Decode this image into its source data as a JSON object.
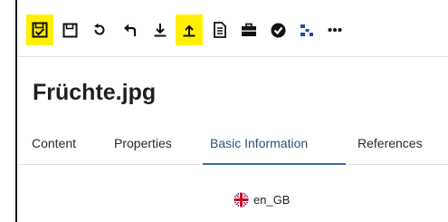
{
  "toolbar": {
    "buttons": [
      {
        "name": "review-icon",
        "highlighted": true
      },
      {
        "name": "save-icon",
        "highlighted": false
      },
      {
        "name": "refresh-icon",
        "highlighted": false
      },
      {
        "name": "undo-icon",
        "highlighted": false
      },
      {
        "name": "download-icon",
        "highlighted": false
      },
      {
        "name": "upload-icon",
        "highlighted": true
      },
      {
        "name": "document-icon",
        "highlighted": false
      },
      {
        "name": "briefcase-icon",
        "highlighted": false
      },
      {
        "name": "check-circle-icon",
        "highlighted": false
      },
      {
        "name": "workflow-icon",
        "highlighted": false
      },
      {
        "name": "more-icon",
        "highlighted": false
      }
    ],
    "highlight_color": "#ffef00"
  },
  "page": {
    "title": "Früchte.jpg"
  },
  "tabs": [
    {
      "label": "Content",
      "active": false
    },
    {
      "label": "Properties",
      "active": false
    },
    {
      "label": "Basic Information",
      "active": true
    },
    {
      "label": "References",
      "active": false
    }
  ],
  "language": {
    "flag": "uk-flag-icon",
    "label": "en_GB"
  },
  "colors": {
    "active_tab_text": "#2d4e7c",
    "active_tab_underline": "#3f6fa4"
  }
}
